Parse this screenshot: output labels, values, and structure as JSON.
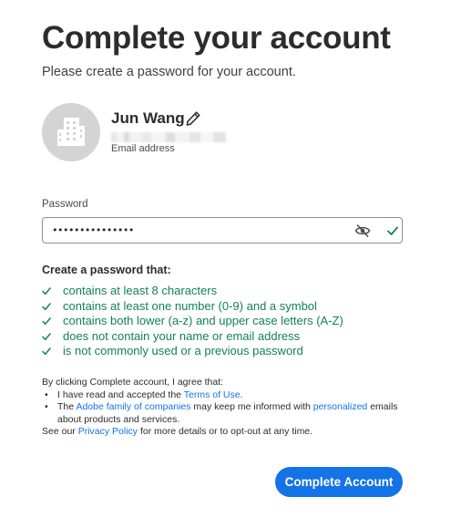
{
  "header": {
    "title": "Complete your account",
    "subtitle": "Please create a password for your account."
  },
  "profile": {
    "avatar_icon": "building-icon",
    "name": "Jun Wang",
    "edit_icon": "pencil-icon",
    "email_label": "Email address"
  },
  "password": {
    "label": "Password",
    "value": "•••••••••••••••",
    "visibility_icon": "eye-slash-icon",
    "status_icon": "checkmark-icon"
  },
  "rules": {
    "heading": "Create a password that:",
    "items": [
      "contains at least 8 characters",
      "contains at least one number (0-9) and a symbol",
      "contains both lower (a-z) and upper case letters (A-Z)",
      "does not contain your name or email address",
      "is not commonly used or a previous password"
    ]
  },
  "legal": {
    "intro": "By clicking Complete account, I agree that:",
    "bullet": "•",
    "item1_pre": "I have read and accepted the ",
    "item1_link": "Terms of Use",
    "item1_post": ".",
    "item2_pre": "The ",
    "item2_link1": "Adobe family of companies",
    "item2_mid": " may keep me informed with ",
    "item2_link2": "personalized",
    "item2_post": " emails about products and services.",
    "outro_pre": "See our ",
    "outro_link": "Privacy Policy",
    "outro_post": " for more details or to opt-out at any time."
  },
  "actions": {
    "complete_label": "Complete Account"
  },
  "colors": {
    "accent": "#1473e6",
    "success": "#12805c",
    "avatar_bg": "#d4d4d4"
  }
}
